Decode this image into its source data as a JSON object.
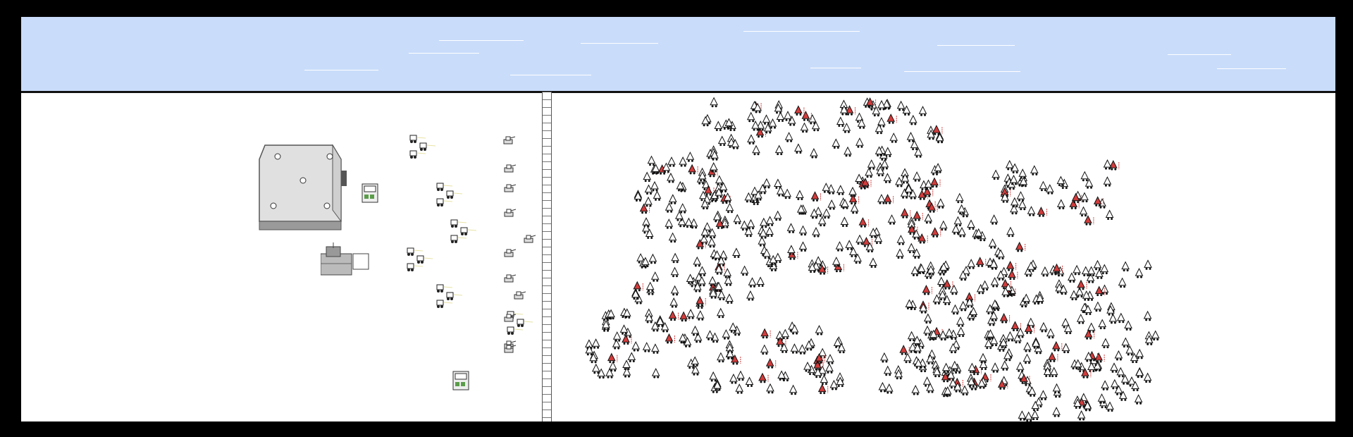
{
  "game": {
    "score_text": "",
    "wave_text": ""
  },
  "colors": {
    "sky": "#c9dcfa",
    "frame": "#000000",
    "ground": "#ffffff",
    "enemy_highlight": "#d23c3c",
    "wall": "#777777",
    "machine_screen": "#5a9c4a"
  },
  "icons": {
    "castle": "castle-icon",
    "barracks": "factory-icon",
    "defender": "robot-icon",
    "catapult": "turret-icon",
    "enemy": "triangle-creature-icon",
    "enemy_leader": "red-flag-creature-icon",
    "machine": "vending-machine-icon",
    "wall": "ladder-wall-icon"
  },
  "defenders": {
    "robot_pairs": 6,
    "catapults": 11
  },
  "enemies": {
    "clusters": 20
  }
}
